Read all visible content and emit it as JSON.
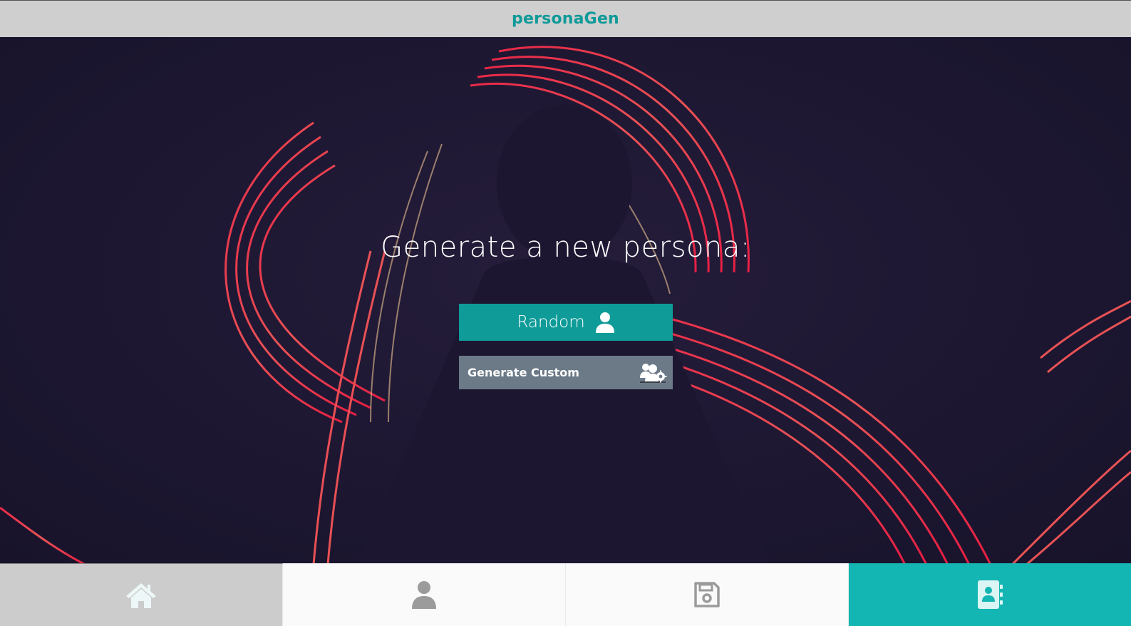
{
  "header": {
    "brand": "personaGen",
    "brand_color": "#0e9a98"
  },
  "hero": {
    "headline": "Generate a new persona:",
    "random_button": {
      "label": "Random",
      "icon": "user-icon",
      "color": "#0f9b98"
    },
    "custom_button": {
      "label": "Generate Custom",
      "icon": "users-cog-icon",
      "color": "#6c7a88"
    }
  },
  "nav": {
    "items": [
      {
        "name": "home",
        "icon": "home-icon",
        "active": false
      },
      {
        "name": "persona",
        "icon": "user-icon",
        "active": false
      },
      {
        "name": "saved",
        "icon": "floppy-disk-icon",
        "active": false
      },
      {
        "name": "contacts",
        "icon": "address-book-icon",
        "active": true
      }
    ],
    "accent": "#13b6b3"
  }
}
